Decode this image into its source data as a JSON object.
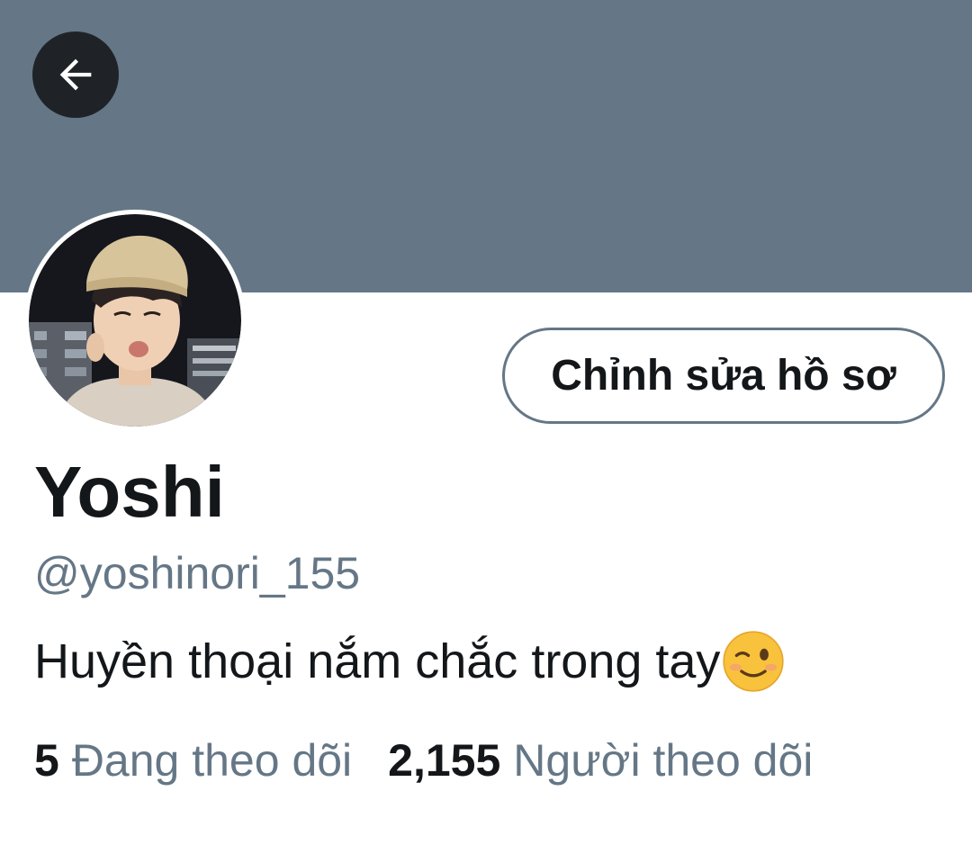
{
  "profile": {
    "display_name": "Yoshi",
    "handle": "@yoshinori_155",
    "bio": "Huyền thoại nắm chắc trong tay",
    "bio_emoji": "winking-face",
    "edit_profile_label": "Chỉnh sửa hồ sơ",
    "following": {
      "count": "5",
      "label": "Đang theo dõi"
    },
    "followers": {
      "count": "2,155",
      "label": "Người theo dõi"
    }
  },
  "icons": {
    "back": "arrow-left-icon"
  },
  "colors": {
    "banner": "#657786",
    "secondary_text": "#657786",
    "primary_text": "#14171a",
    "back_button_bg": "#1f2327"
  }
}
